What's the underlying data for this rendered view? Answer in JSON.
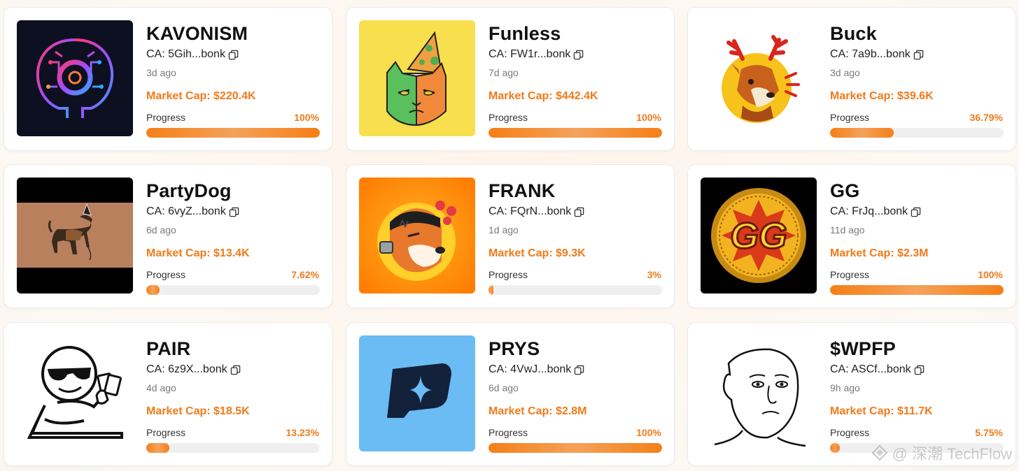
{
  "colors": {
    "accent": "#f07a1a",
    "bar_track": "#efefef"
  },
  "tokens": [
    {
      "name": "KAVONISM",
      "ca": "CA: 5Gih...bonk",
      "age": "3d ago",
      "market_cap": "Market Cap: $220.4K",
      "progress_label": "Progress",
      "progress_text": "100%",
      "progress_value": 100,
      "image": "ai-brain-logo"
    },
    {
      "name": "Funless",
      "ca": "CA: FW1r...bonk",
      "age": "7d ago",
      "market_cap": "Market Cap: $442.4K",
      "progress_label": "Progress",
      "progress_text": "100%",
      "progress_value": 100,
      "image": "grumpy-cat-party-hat"
    },
    {
      "name": "Buck",
      "ca": "CA: 7a9b...bonk",
      "age": "3d ago",
      "market_cap": "Market Cap: $39.6K",
      "progress_label": "Progress",
      "progress_text": "36.79%",
      "progress_value": 36.79,
      "image": "deer-logo"
    },
    {
      "name": "PartyDog",
      "ca": "CA: 6vyZ...bonk",
      "age": "6d ago",
      "market_cap": "Market Cap: $13.4K",
      "progress_label": "Progress",
      "progress_text": "7.62%",
      "progress_value": 7.62,
      "image": "party-dog"
    },
    {
      "name": "FRANK",
      "ca": "CA: FQrN...bonk",
      "age": "1d ago",
      "market_cap": "Market Cap: $9.3K",
      "progress_label": "Progress",
      "progress_text": "3%",
      "progress_value": 3,
      "image": "frankenstein-dog"
    },
    {
      "name": "GG",
      "ca": "CA: FrJq...bonk",
      "age": "11d ago",
      "market_cap": "Market Cap: $2.3M",
      "progress_label": "Progress",
      "progress_text": "100%",
      "progress_value": 100,
      "image": "gg-coin"
    },
    {
      "name": "PAIR",
      "ca": "CA: 6z9X...bonk",
      "age": "4d ago",
      "market_cap": "Market Cap: $18.5K",
      "progress_label": "Progress",
      "progress_text": "13.23%",
      "progress_value": 13.23,
      "image": "sunglasses-cards-guy"
    },
    {
      "name": "PRYS",
      "ca": "CA: 4VwJ...bonk",
      "age": "6d ago",
      "market_cap": "Market Cap: $2.8M",
      "progress_label": "Progress",
      "progress_text": "100%",
      "progress_value": 100,
      "image": "p-star-logo"
    },
    {
      "name": "$WPFP",
      "ca": "CA: ASCf...bonk",
      "age": "9h ago",
      "market_cap": "Market Cap: $11.7K",
      "progress_label": "Progress",
      "progress_text": "5.75%",
      "progress_value": 5.75,
      "image": "wojak-face"
    }
  ],
  "watermark": {
    "text": "@ 深潮 TechFlow",
    "icon": "techflow-logo-icon"
  }
}
